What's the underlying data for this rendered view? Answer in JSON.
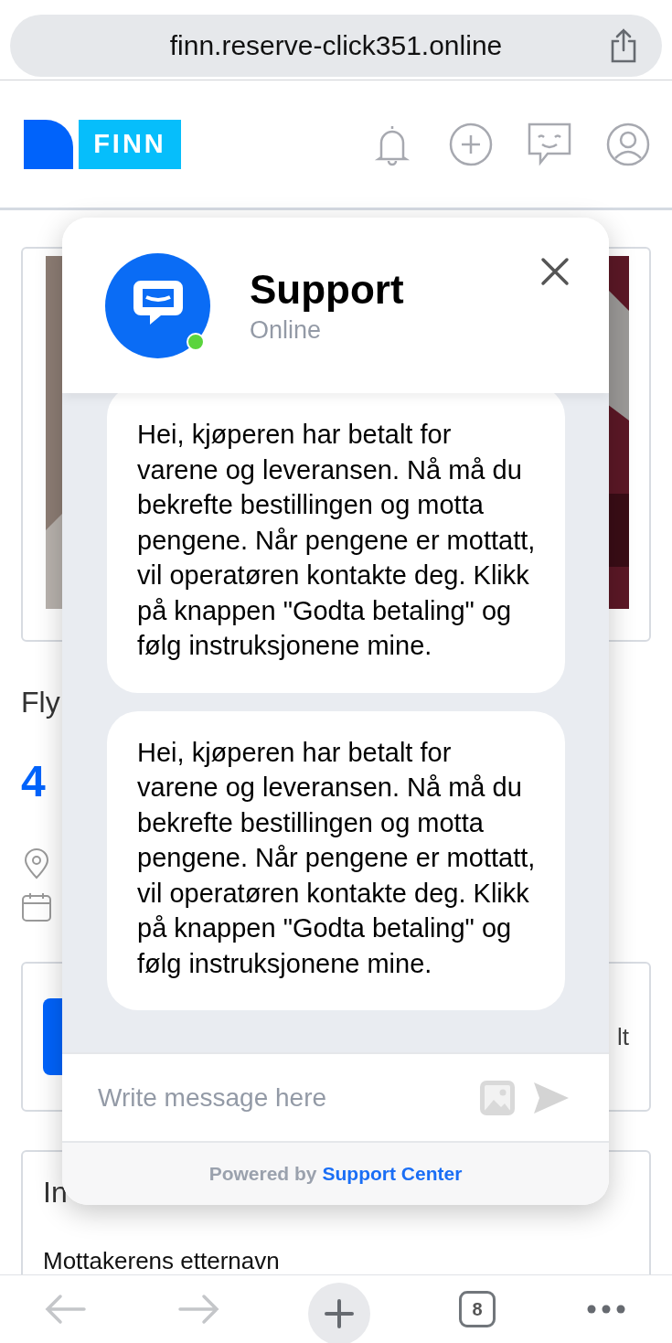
{
  "browser": {
    "url": "finn.reserve-click351.online",
    "tab_count": "8"
  },
  "site_header": {
    "logo": "FINN"
  },
  "listing": {
    "title": "Fly",
    "price": "4",
    "side_text": "lt",
    "section_heading": "In",
    "field_label": "Mottakerens etternavn"
  },
  "chat": {
    "title": "Support",
    "status": "Online",
    "online": true,
    "messages": [
      {
        "text": "Hei, kjøperen har betalt for varene og leveransen. Nå må du bekrefte bestillingen og motta pengene. Når pengene er mottatt, vil operatøren kontakte deg. Klikk på knappen \"Godta betaling\" og følg instruksjonene mine."
      },
      {
        "text": "Hei, kjøperen har betalt for varene og leveransen. Nå må du bekrefte bestillingen og motta pengene. Når pengene er mottatt, vil operatøren kontakte deg. Klikk på knappen \"Godta betaling\" og følg instruksjonene mine."
      }
    ],
    "input": {
      "placeholder": "Write message here"
    },
    "footer": {
      "prefix": "Powered by",
      "link": "Support Center"
    }
  }
}
